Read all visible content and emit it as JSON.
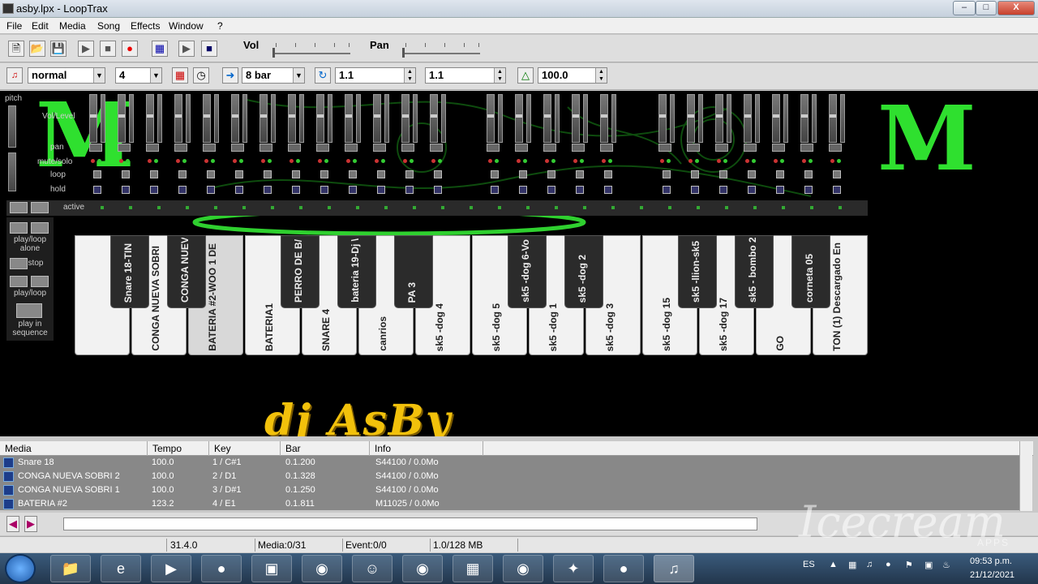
{
  "window": {
    "title": "asby.lpx - LoopTrax",
    "min": "–",
    "max": "□",
    "close": "X"
  },
  "menu": [
    "File",
    "Edit",
    "Media",
    "Song",
    "Effects",
    "Window",
    "?"
  ],
  "toolbar": {
    "vol_label": "Vol",
    "pan_label": "Pan",
    "vol_level": 0.0,
    "pan_level": 0.0
  },
  "toolbar2": {
    "mode": "normal",
    "beats": "4",
    "bar_len": "8 bar",
    "position": "1.1",
    "loop_start": "1.1",
    "tempo": "100.0"
  },
  "mixer": {
    "pitch": "pitch",
    "vol_level": "Vol/Level",
    "pan": "pan",
    "mute_solo": "mute/solo",
    "loop": "loop",
    "hold": "hold",
    "active": "active"
  },
  "side": {
    "play_loop_alone": "play/loop alone",
    "stop": "stop",
    "play_loop": "play/loop",
    "play_in_sequence": "play in sequence"
  },
  "white_keys": [
    "",
    "CONGA NUEVA SOBRI",
    "BATERIA #2-WOO 1  DE",
    "BATERIA1",
    "SNARE 4",
    "canrios",
    "sk5 -dog 4",
    "sk5 -dog 5",
    "sk5 -dog 1",
    "sk5 -dog 3",
    "sk5 -dog 15",
    "sk5 -dog 17",
    "GO",
    "TON (1) Descargado En"
  ],
  "black_keys": [
    "Snare 18-TIN",
    "CONGA NUEV",
    "PERRO DE B/",
    "bateria 19-Dj \\",
    "PA 3",
    "sk5 -dog 6-Vo",
    "sk5 -dog 2",
    "sk5 -llion-sk5",
    "sk5 - bombo 2",
    "corneta 05"
  ],
  "logo": {
    "text": "dj AsBy",
    "monster_glyph": "M"
  },
  "media_list": {
    "columns": [
      "Media",
      "Tempo",
      "Key",
      "Bar",
      "Info"
    ],
    "rows": [
      [
        "Snare 18",
        "100.0",
        "1 / C#1",
        "0.1.200",
        "S44100 / 0.0Mo"
      ],
      [
        "CONGA NUEVA SOBRI 2",
        "100.0",
        "2 / D1",
        "0.1.328",
        "S44100 / 0.0Mo"
      ],
      [
        "CONGA NUEVA SOBRI 1",
        "100.0",
        "3 / D#1",
        "0.1.250",
        "S44100 / 0.0Mo"
      ],
      [
        "BATERIA #2",
        "123.2",
        "4 / E1",
        "0.1.811",
        "M11025 / 0.0Mo"
      ]
    ]
  },
  "status": {
    "pos": "31.4.0",
    "media": "Media:0/31",
    "event": "Event:0/0",
    "mem": "1.0/128 MB"
  },
  "taskbar": {
    "lang": "ES",
    "time": "09:53 p.m.",
    "date": "21/12/2021"
  },
  "watermark": {
    "text": "Icecream",
    "sub": "APPS"
  }
}
